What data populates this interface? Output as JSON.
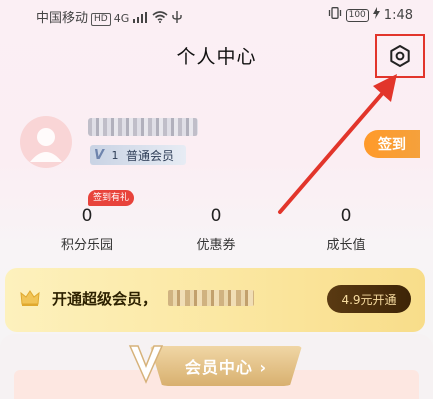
{
  "status_bar": {
    "carrier": "中国移动",
    "hd_badge": "HD",
    "network": "4G",
    "battery": "100",
    "time": "1:48"
  },
  "header": {
    "title": "个人中心"
  },
  "profile": {
    "member_level": "1",
    "member_tier": "普通会员",
    "signin_label": "签到"
  },
  "stats": {
    "promo_badge": "签到有礼",
    "items": [
      {
        "value": "0",
        "label": "积分乐园"
      },
      {
        "value": "0",
        "label": "优惠券"
      },
      {
        "value": "0",
        "label": "成长值"
      }
    ]
  },
  "vip": {
    "text": "开通超级会员，",
    "button_label": "4.9元开通"
  },
  "member_center": {
    "label": "会员中心 ›"
  },
  "colors": {
    "accent_red": "#e2352b",
    "signin_orange": "#ff9a2a",
    "vip_gold": "#fbe7a1",
    "vip_button": "#3d2407"
  },
  "icons": [
    "settings-icon",
    "crown-icon",
    "wifi-icon",
    "usb-icon",
    "vibrate-icon",
    "charging-icon"
  ]
}
